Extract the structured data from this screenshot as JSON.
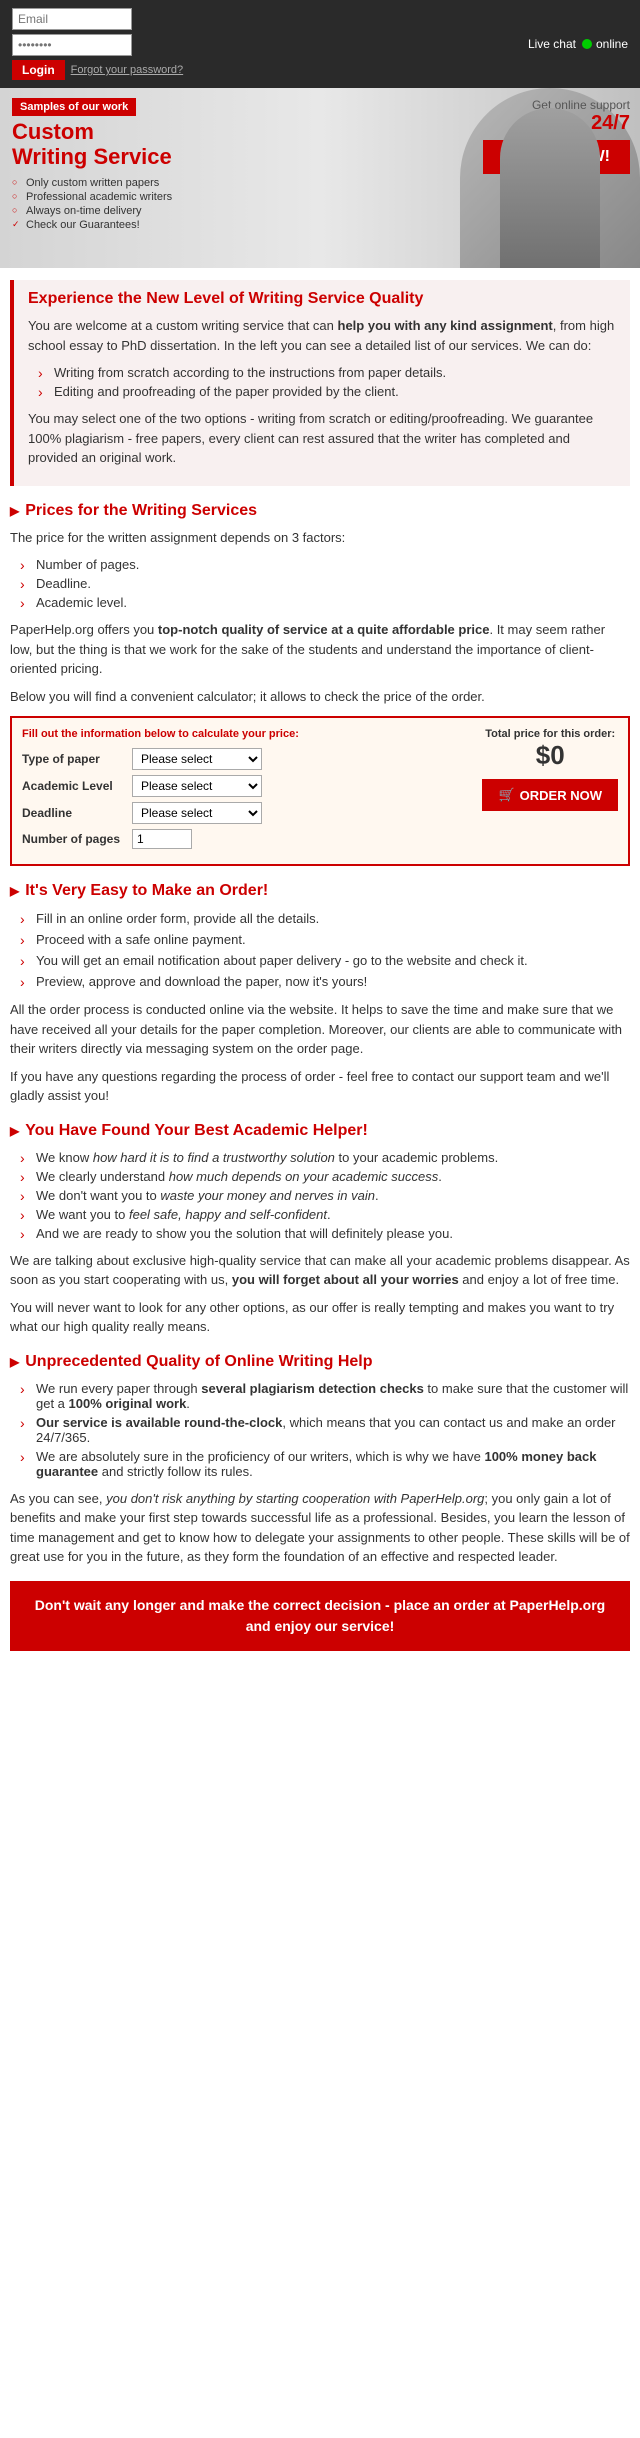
{
  "header": {
    "email_placeholder": "Email",
    "password_placeholder": "••••••••",
    "login_label": "Login",
    "forgot_password": "Forgot your password?",
    "live_chat_label": "Live chat",
    "online_label": "online"
  },
  "banner": {
    "samples_tag": "Samples of our work",
    "title_line1": "Custom",
    "title_line2": "Writing Service",
    "features": [
      "Only custom written papers",
      "Professional academic writers",
      "Always on-time delivery",
      "Check our Guarantees!"
    ],
    "support_text": "Get online support",
    "support_247": "24/7",
    "order_btn": "ORDER NOW!"
  },
  "experience": {
    "title": "Experience the New Level of Writing Service Quality",
    "para1_pre": "You are welcome at a custom writing service that can ",
    "para1_bold": "help you with any kind assignment",
    "para1_post": ", from high school essay to PhD dissertation. In the left you can see a detailed list of our services. We can do:",
    "list": [
      "Writing from scratch according to the instructions from paper details.",
      "Editing and proofreading of the paper provided by the client."
    ],
    "para2": "You may select one of the two options - writing from scratch or editing/proofreading. We guarantee 100% plagiarism - free papers, every client can rest assured that the writer has completed and provided an original work."
  },
  "prices": {
    "heading": "Prices for the Writing Services",
    "intro": "The price for the written assignment depends on 3 factors:",
    "factors": [
      "Number of pages.",
      "Deadline.",
      "Academic level."
    ],
    "para1_pre": "PaperHelp.org offers you ",
    "para1_bold": "top-notch quality of service at a quite affordable price",
    "para1_post": ". It may seem rather low, but the thing is that we work for the sake of the students and understand the importance of client-oriented pricing.",
    "para2": "Below you will find a convenient calculator; it allows to check the price of the order."
  },
  "calculator": {
    "form_title": "Fill out the information below to calculate your price:",
    "total_label": "Total price for this order:",
    "price": "$0",
    "fields": {
      "type_label": "Type of paper",
      "type_placeholder": "Please select",
      "academic_label": "Academic Level",
      "academic_placeholder": "Please select",
      "deadline_label": "Deadline",
      "deadline_placeholder": "Please select",
      "pages_label": "Number of pages"
    },
    "order_btn": "ORDER NOW"
  },
  "easy_order": {
    "heading": "It's Very Easy to Make an Order!",
    "steps": [
      "Fill in an online order form, provide all the details.",
      "Proceed with a safe online payment.",
      "You will get an email notification about paper delivery - go to the website and check it.",
      "Preview, approve and download the paper, now it's yours!"
    ],
    "para": "All the order process is conducted online via the website. It helps to save the time and make sure that we have received all your details for the paper completion. Moreover, our clients are able to communicate with their writers directly via messaging system on the order page.",
    "para2": "If you have any questions regarding the process of order - feel free to contact our support team and we'll gladly assist you!"
  },
  "best_helper": {
    "heading": "You Have Found Your Best Academic Helper!",
    "items": [
      {
        "pre": "We know ",
        "italic": "how hard it is to find a trustworthy solution",
        "post": " to your academic problems."
      },
      {
        "pre": "We clearly understand ",
        "italic": "how much depends on your academic success",
        "post": "."
      },
      {
        "pre": "We don't want you to ",
        "italic": "waste your money and nerves in vain",
        "post": "."
      },
      {
        "pre": "We want you to ",
        "italic": "feel safe, happy and self-confident",
        "post": "."
      },
      {
        "pre": "And we are ready to show you the solution that will definitely please you.",
        "italic": "",
        "post": ""
      }
    ],
    "para1": "We are talking about exclusive high-quality service that can make all your academic problems disappear. As soon as you start cooperating with us, ",
    "para1_bold": "you will forget about all your worries",
    "para1_post": " and enjoy a lot of free time.",
    "para2": "You will never want to look for any other options, as our offer is really tempting and makes you want to try what our high quality really means."
  },
  "unprecedented": {
    "heading": "Unprecedented Quality of Online Writing Help",
    "items": [
      {
        "pre": "We run every paper through ",
        "bold": "several plagiarism detection checks",
        "post": " to make sure that the customer will get a ",
        "bold2": "100% original work",
        "post2": "."
      },
      {
        "pre_bold": "Our service is available round-the-clock",
        "post": ", which means that you can contact us and make an order 24/7/365."
      },
      {
        "pre": "We are absolutely sure in the proficiency of our writers, which is why we have ",
        "bold": "100% money back guarantee",
        "post": " and strictly follow its rules."
      }
    ],
    "para1_italic": "you don't risk anything by starting cooperation with PaperHelp.org",
    "para1_pre": "As you can see, ",
    "para1_post": "; you only gain a lot of benefits and make your first step towards successful life as a professional. Besides, you learn the lesson of time management and get to know how to delegate your assignments to other people. These skills will be of great use for you in the future, as they form the foundation of an effective and respected leader.",
    "cta_pre": "Don't wait any longer and make the correct decision - place an order at ",
    "cta_brand": "PaperHelp.org",
    "cta_post": " and enjoy our service!"
  }
}
